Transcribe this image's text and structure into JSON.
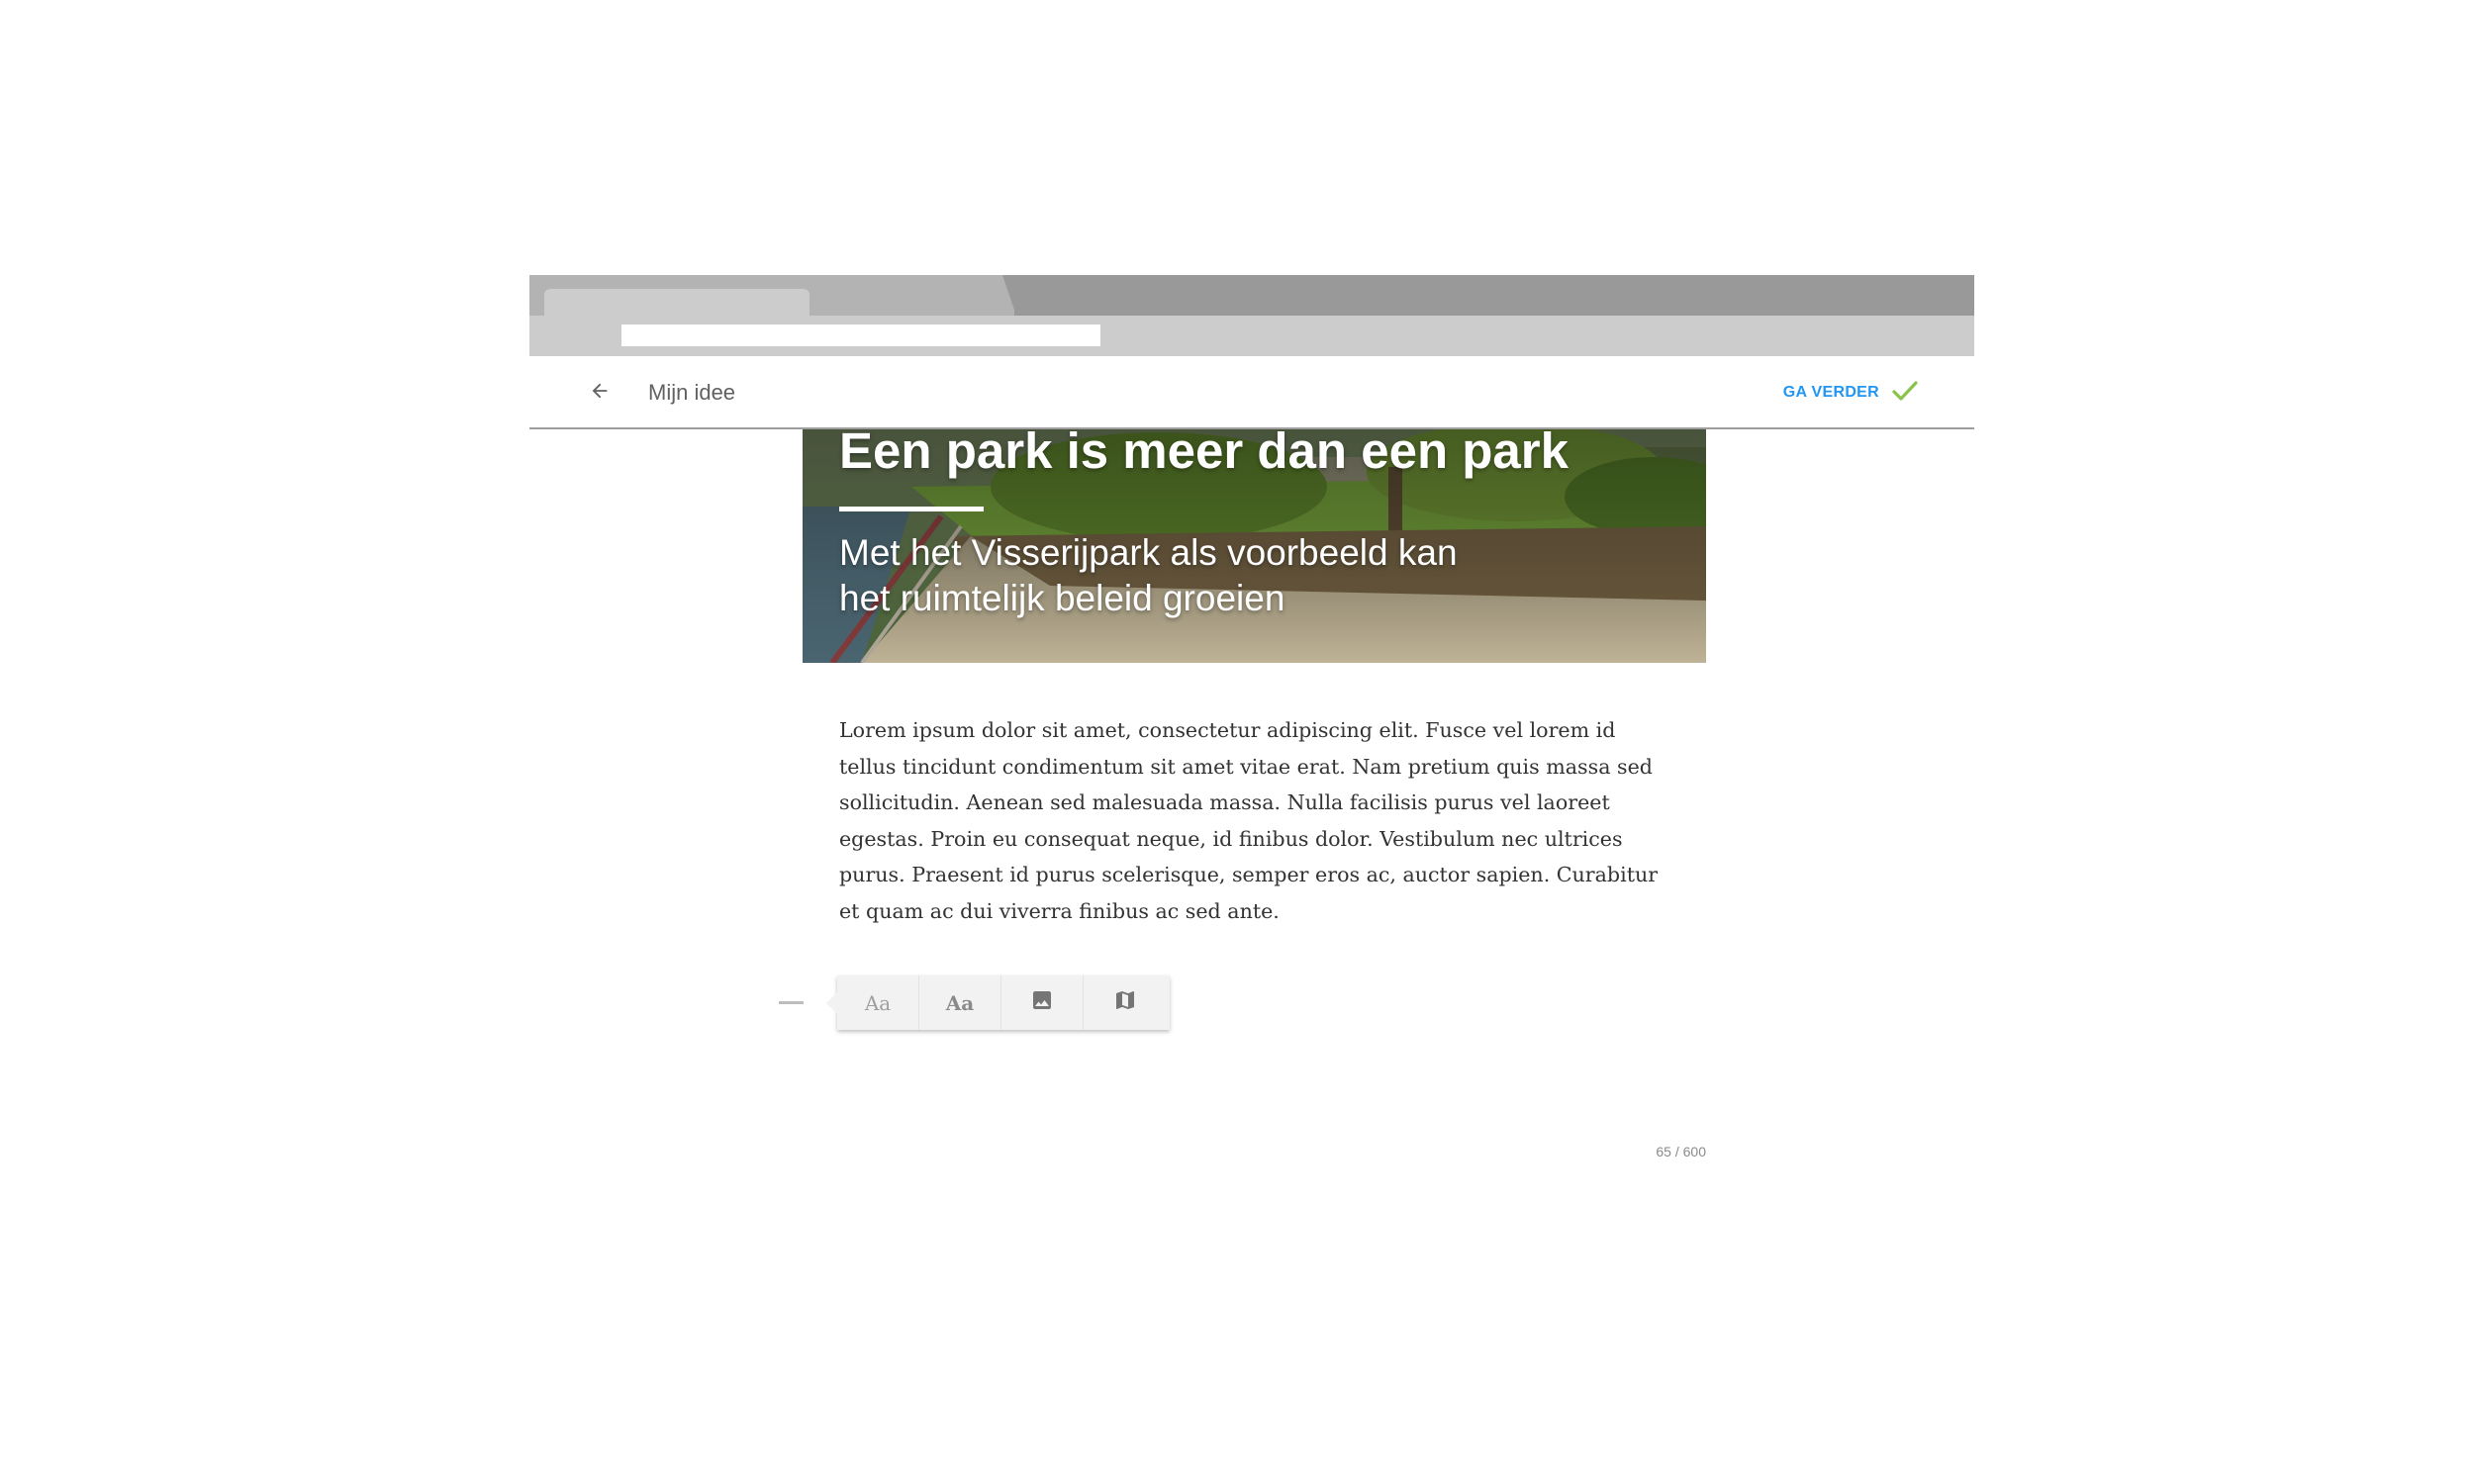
{
  "app_bar": {
    "title": "Mijn idee",
    "continue_label": "GA VERDER",
    "accent_color": "#2196f3",
    "check_color": "#8bc34a"
  },
  "icons": {
    "back": "arrow-left-icon",
    "continue": "check-icon",
    "text_regular": "text-style-icon",
    "text_bold": "text-bold-style-icon",
    "image": "image-icon",
    "map": "map-icon"
  },
  "hero": {
    "title": "Een park is meer dan een park",
    "subtitle": "Met het Visserijpark als voorbeeld kan het ruimtelijk beleid groeien"
  },
  "body": {
    "text": "Lorem ipsum dolor sit amet, consectetur adipiscing elit. Fusce vel lorem id tellus tincidunt condimentum sit amet vitae erat. Nam pretium quis massa sed sollicitudin. Aenean sed malesuada massa. Nulla facilisis purus vel laoreet egestas. Proin eu consequat neque, id finibus dolor. Vestibulum nec ultrices purus. Praesent id purus scelerisque, semper eros ac, auctor sapien. Curabitur et quam ac dui viverra finibus ac sed ante."
  },
  "toolbar": {
    "text_regular_label": "Aa",
    "text_bold_label": "Aa"
  },
  "counter": {
    "text": "65 / 600"
  }
}
